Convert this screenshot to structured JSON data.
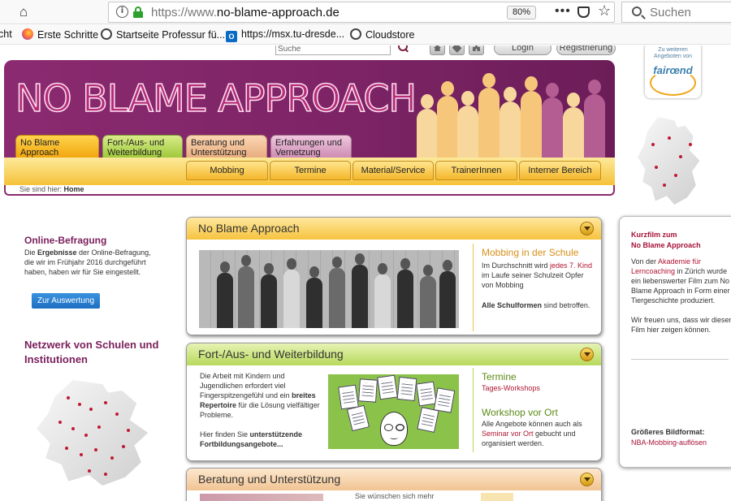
{
  "browser": {
    "url_prefix": "https://www.",
    "url_domain": "no-blame-approach.de",
    "zoom": "80%",
    "search_placeholder": "Suchen",
    "bookmarks": [
      {
        "label": "cht",
        "icon": "none"
      },
      {
        "label": "Erste Schritte",
        "icon": "firefox-icon"
      },
      {
        "label": "Startseite Professur fü...",
        "icon": "tu-dresden-icon"
      },
      {
        "label": "https://msx.tu-dresde...",
        "icon": "outlook-icon"
      },
      {
        "label": "Cloudstore",
        "icon": "tu-dresden-icon"
      }
    ]
  },
  "site": {
    "search_placeholder": "Suche",
    "login": "Login",
    "register": "Registrierung",
    "title": "NO BLAME APPROACH",
    "partner": {
      "small": "Zu weiteren Angeboten von",
      "logo": "fairœnd"
    },
    "main_tabs": [
      "No Blame Approach",
      "Fort-/Aus- und Weiterbildung",
      "Beratung und Unterstützung",
      "Erfahrungen und Vernetzung"
    ],
    "sub_nav": [
      "Mobbing",
      "Termine",
      "Material/Service",
      "TrainerInnen",
      "Interner Bereich"
    ],
    "breadcrumb": {
      "prefix": "Sie sind hier:",
      "current": "Home"
    }
  },
  "left": {
    "survey": {
      "title": "Online-Befragung",
      "t1": "Die ",
      "b1": "Ergebnisse",
      "t2": " der Online-Befragung, die wir im Frühjahr 2016 durchgeführt haben, haben wir für Sie eingestellt.",
      "button": "Zur Auswertung"
    },
    "network_title": "Netzwerk von Schulen und Institutionen"
  },
  "boxes": {
    "nba": {
      "title": "No Blame Approach",
      "side_title": "Mobbing in der Schule",
      "p1a": "Im Durchschnitt wird ",
      "p1b": "jedes 7. Kind",
      "p1c": " im Laufe seiner Schulzeit Opfer von Mobbing",
      "p2a": "Alle Schulformen",
      "p2b": " sind betroffen."
    },
    "fort": {
      "title": "Fort-/Aus- und Weiterbildung",
      "t1": "Die Arbeit mit Kindern und Jugendlichen erfordert viel Fingerspitzengefühl und ein ",
      "b1": "breites Repertoire",
      "t2": " für die Lösung vielfältiger Probleme.",
      "t3": "Hier finden Sie ",
      "b2": "unterstützende Fortbildungsangebote...",
      "termine_title": "Termine",
      "termine_link": "Tages-Workshops",
      "ws_title": "Workshop vor Ort",
      "ws_a": "Alle Angebote können auch als ",
      "ws_link": "Seminar vor Ort",
      "ws_b": " gebucht und organisiert werden."
    },
    "beratung": {
      "title": "Beratung und Unterstützung",
      "partial": "Sie wünschen sich mehr"
    }
  },
  "right": {
    "title1": "Kurzfilm zum",
    "title2": "No Blame Approach",
    "t1": "Von der ",
    "link": "Akademie für Lerncoaching",
    "t2": " in Zürich wurde ein liebenswerter Film zum No Blame Approach in Form einer Tiergeschichte produziert.",
    "t3": "Wir freuen uns, dass wir diesen Film hier zeigen können.",
    "bigger_title": "Größeres Bildformat:",
    "bigger_link": "NBA-Mobbing-auflösen"
  }
}
